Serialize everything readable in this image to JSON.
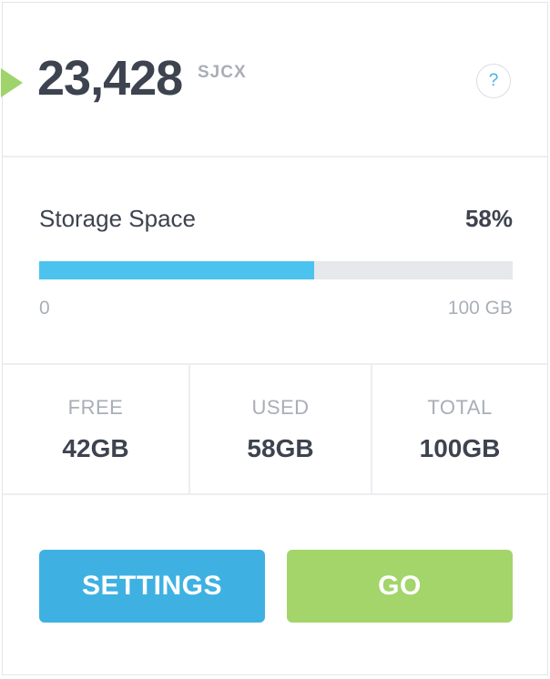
{
  "balance": {
    "amount": "23,428",
    "unit": "SJCX",
    "help_label": "?"
  },
  "storage": {
    "title": "Storage Space",
    "percent_label": "58%",
    "used_fraction": 0.58,
    "min_label": "0",
    "max_label": "100 GB"
  },
  "stats": [
    {
      "label": "FREE",
      "value": "42GB"
    },
    {
      "label": "USED",
      "value": "58GB"
    },
    {
      "label": "TOTAL",
      "value": "100GB"
    }
  ],
  "buttons": {
    "settings_label": "SETTINGS",
    "go_label": "GO"
  },
  "colors": {
    "accent_blue": "#3eb1e2",
    "progress_blue": "#4cc3ee",
    "accent_green": "#a3d56a",
    "text_dark": "#3d434f",
    "text_muted": "#a9aeb6"
  }
}
